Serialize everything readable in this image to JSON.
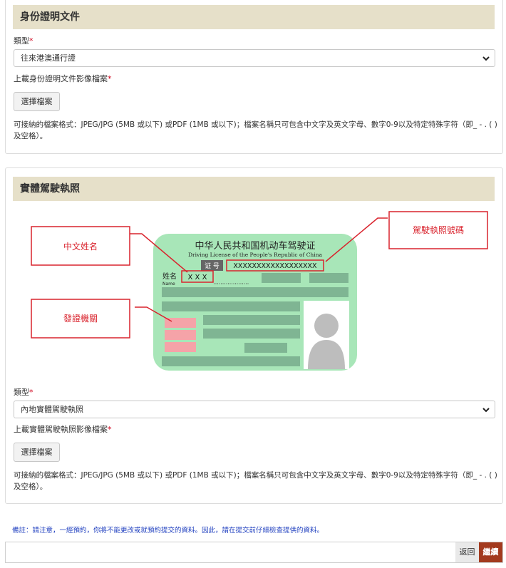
{
  "id_section": {
    "title": "身份證明文件",
    "type_label": "類型",
    "required_mark": "*",
    "type_value": "往來港澳通行證",
    "upload_label": "上載身份證明文件影像檔案",
    "file_button": "選擇檔案",
    "format_note": "可接納的檔案格式：JPEG/JPG (5MB 或以下) 或PDF (1MB 或以下)；檔案名稱只可包含中文字及英文字母、數字0-9以及特定特殊字符（即_ - . ( ) 及空格）。"
  },
  "license_section": {
    "title": "實體駕駛執照",
    "illustration": {
      "callout_name": "中文姓名",
      "callout_number": "駕駛執照號碼",
      "callout_authority": "發證機關",
      "card_title_cn": "中华人民共和国机动车驾驶证",
      "card_title_en": "Driving License of the People's Republic of China",
      "id_label": "证 号",
      "id_value": "XXXXXXXXXXXXXXXXXX",
      "name_label_cn": "姓名",
      "name_label_en": "Name",
      "name_value": "X X X"
    },
    "type_label": "類型",
    "required_mark": "*",
    "type_value": "內地實體駕駛執照",
    "upload_label": "上載實體駕駛執照影像檔案",
    "file_button": "選擇檔案",
    "format_note": "可接納的檔案格式：JPEG/JPG (5MB 或以下) 或PDF (1MB 或以下)；檔案名稱只可包含中文字及英文字母、數字0-9以及特定特殊字符（即_ - . ( ) 及空格）。"
  },
  "remark": "備註：請注意，一經預約，你將不能更改或就預約提交的資料。因此，請在提交前仔細檢查提供的資料。",
  "actions": {
    "back": "返回",
    "continue": "繼續"
  },
  "colors": {
    "header_bg": "#e6e0c9",
    "required": "#d0021b",
    "card_green": "#a8e6b8",
    "callout_red": "#d9232d",
    "continue_bg": "#a33a1e",
    "remark_text": "#1f3fbf"
  },
  "icons": {
    "select_chevron": "chevron-down-icon",
    "avatar": "person-silhouette-icon"
  }
}
